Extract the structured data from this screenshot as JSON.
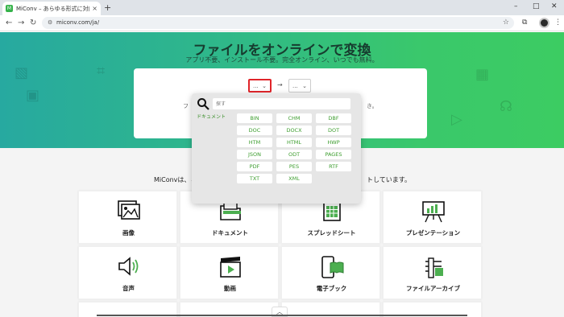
{
  "browser": {
    "tab_title": "MiConv – あらゆる形式に対応した",
    "tab_favicon": "M",
    "tab_close": "×",
    "new_tab": "+",
    "url": "miconv.com/ja/",
    "window_controls": [
      "–",
      "□",
      "✕"
    ]
  },
  "hero": {
    "title": "ファイルをオンラインで変換",
    "subtitle": "アプリ不要、インストール不要。完全オンライン、いつでも無料。"
  },
  "converter": {
    "from_value": "...",
    "to_value": "...",
    "arrow": "→",
    "hint_left": "フ",
    "hint_right": "き。"
  },
  "dropdown": {
    "search_placeholder": "探す",
    "category": "ドキュメント",
    "formats": [
      "BIN",
      "CHM",
      "DBF",
      "DOC",
      "DOCX",
      "DOT",
      "HTM",
      "HTML",
      "HWP",
      "JSON",
      "ODT",
      "PAGES",
      "PDF",
      "PES",
      "RTF",
      "TXT",
      "XML"
    ]
  },
  "intro": {
    "left": "MiConvは、ミ",
    "right": "トしています。"
  },
  "categories": [
    {
      "label": "画像",
      "icon": "image-icon"
    },
    {
      "label": "ドキュメント",
      "icon": "document-icon"
    },
    {
      "label": "スプレッドシート",
      "icon": "spreadsheet-icon"
    },
    {
      "label": "プレゼンテーション",
      "icon": "presentation-icon"
    },
    {
      "label": "音声",
      "icon": "audio-icon"
    },
    {
      "label": "動画",
      "icon": "video-icon"
    },
    {
      "label": "電子ブック",
      "icon": "ebook-icon"
    },
    {
      "label": "ファイルアーカイブ",
      "icon": "archive-icon"
    }
  ],
  "colors": {
    "accent": "#3ac86b",
    "format_text": "#3c9d2e",
    "highlight_border": "#e0252a"
  }
}
